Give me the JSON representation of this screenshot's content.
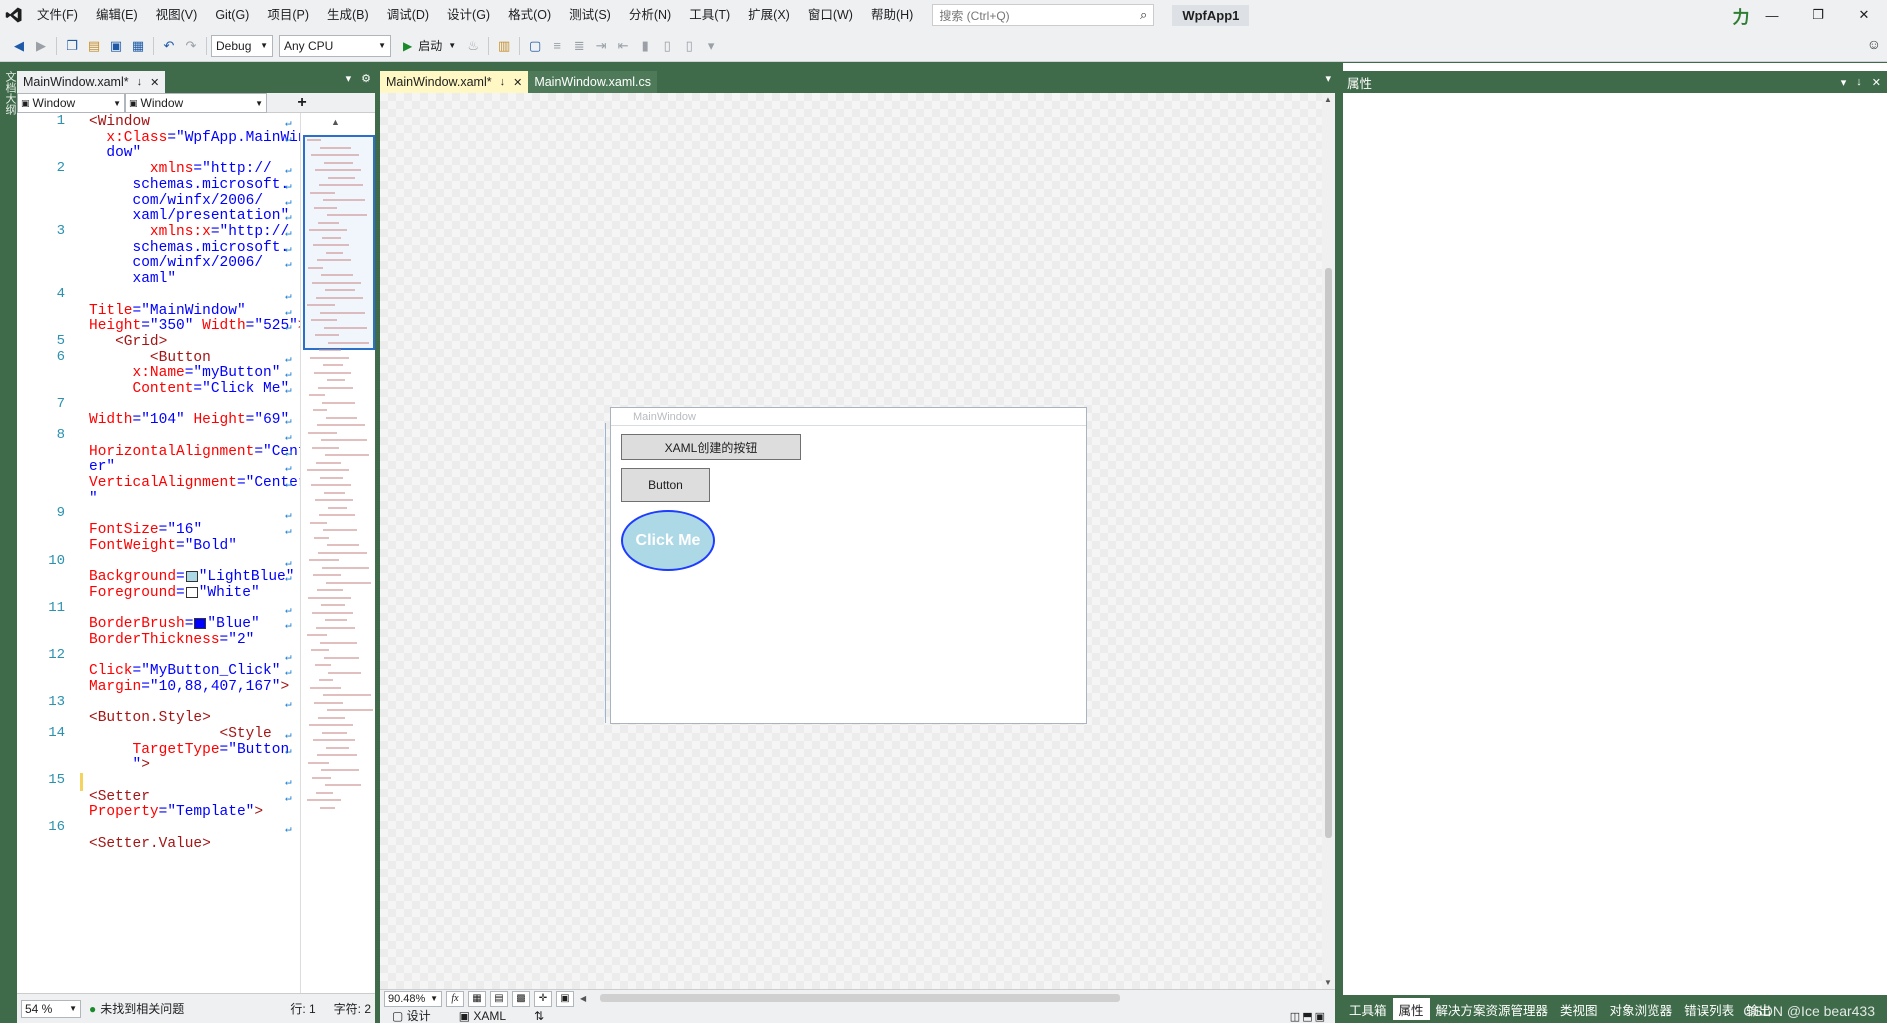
{
  "menubar": {
    "items": [
      "文件(F)",
      "编辑(E)",
      "视图(V)",
      "Git(G)",
      "项目(P)",
      "生成(B)",
      "调试(D)",
      "设计(G)",
      "格式(O)",
      "测试(S)",
      "分析(N)",
      "工具(T)",
      "扩展(X)",
      "窗口(W)",
      "帮助(H)"
    ],
    "search_placeholder": "搜索 (Ctrl+Q)",
    "app_title": "WpfApp1",
    "account_glyph": "力"
  },
  "toolbar": {
    "config": "Debug",
    "platform": "Any CPU",
    "start_label": "启动"
  },
  "left_strip": {
    "label": "文档大纲"
  },
  "editor": {
    "tab_label": "MainWindow.xaml*",
    "nav_left": "Window",
    "nav_right": "Window",
    "nav_plus": "+",
    "line_numbers": [
      "1",
      "2",
      "3",
      "4",
      "5",
      "6",
      "7",
      "8",
      "9",
      "10",
      "11",
      "12",
      "13",
      "14",
      "15",
      "16"
    ],
    "zoom": "54 %",
    "status": "未找到相关问题",
    "row": "行: 1",
    "char": "字符: 2"
  },
  "designer": {
    "tab_active": "MainWindow.xaml*",
    "tab_inactive": "MainWindow.xaml.cs",
    "window_title": "MainWindow",
    "xaml_button": "XAML创建的按钮",
    "code_button": "Button",
    "ellipse_button": "Click Me",
    "zoom": "90.48%",
    "fx_label": "fx",
    "view_design": "设计",
    "view_xaml": "XAML"
  },
  "properties": {
    "title": "属性",
    "tabs": [
      "工具箱",
      "属性",
      "解决方案资源管理器",
      "类视图",
      "对象浏览器",
      "错误列表",
      "输出"
    ],
    "watermark": "CSDN @Ice  bear433"
  },
  "colors": {
    "accent_green": "#3f6b4a",
    "light_blue": "#add8e6",
    "blue": "#0000ff"
  }
}
